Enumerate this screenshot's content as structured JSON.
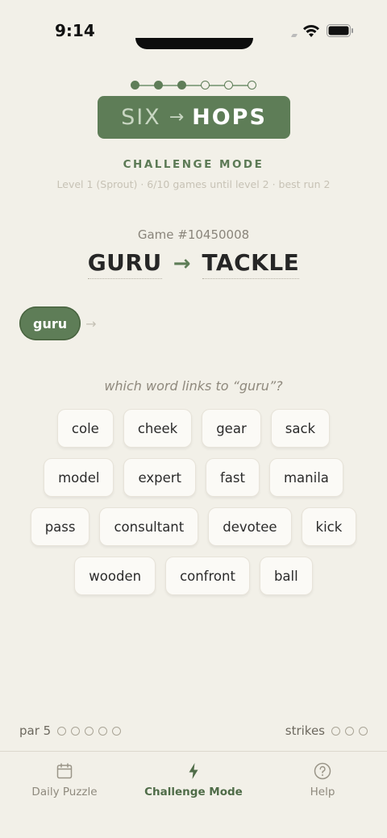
{
  "status": {
    "time": "9:14"
  },
  "progress": {
    "total": 6,
    "completed": 3
  },
  "logo": {
    "left": "SIX",
    "arrow": "→",
    "right": "HOPS"
  },
  "mode": {
    "title": "CHALLENGE MODE",
    "level_info": "Level 1 (Sprout) · 6/10 games until level 2 · best run 2"
  },
  "game": {
    "number": "Game #10450008",
    "start_word": "GURU",
    "arrow": "→",
    "end_word": "TACKLE"
  },
  "chain": {
    "words": [
      "guru"
    ],
    "arrow": "→"
  },
  "prompt": "which word links to “guru”?",
  "options": [
    [
      "cole",
      "cheek",
      "gear",
      "sack"
    ],
    [
      "model",
      "expert",
      "fast",
      "manila"
    ],
    [
      "pass",
      "consultant",
      "devotee",
      "kick"
    ],
    [
      "wooden",
      "confront",
      "ball"
    ]
  ],
  "stats": {
    "par_label": "par 5",
    "par_count": 5,
    "strikes_label": "strikes",
    "strikes_count": 3
  },
  "tabs": [
    {
      "label": "Daily Puzzle",
      "icon": "calendar-icon",
      "active": false
    },
    {
      "label": "Challenge Mode",
      "icon": "lightning-icon",
      "active": true
    },
    {
      "label": "Help",
      "icon": "help-icon",
      "active": false
    }
  ],
  "colors": {
    "accent": "#5e7d57",
    "background": "#f2f0e8"
  }
}
